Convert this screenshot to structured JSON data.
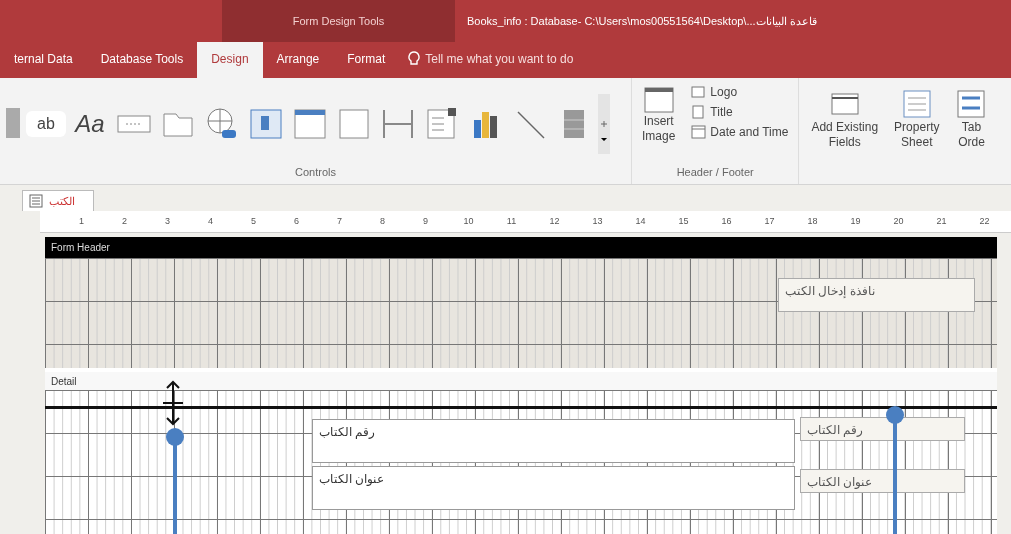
{
  "window": {
    "context_title": "Form Design Tools",
    "title": "Books_info : Database- C:\\Users\\mos00551564\\Desktop\\...قاعدة البيانات"
  },
  "tabs": [
    {
      "label": "ternal Data",
      "selected": false
    },
    {
      "label": "Database Tools",
      "selected": false
    },
    {
      "label": "Design",
      "selected": true
    },
    {
      "label": "Arrange",
      "selected": false
    },
    {
      "label": "Format",
      "selected": false
    }
  ],
  "tell_me": {
    "placeholder": "Tell me what you want to do"
  },
  "ribbon": {
    "controls": [
      {
        "kind": "select"
      },
      {
        "kind": "textbox",
        "glyph": "ab"
      },
      {
        "kind": "label",
        "glyph": "Aa"
      },
      {
        "kind": "button"
      },
      {
        "kind": "tab"
      },
      {
        "kind": "hyperlink"
      },
      {
        "kind": "navigation"
      },
      {
        "kind": "frame"
      },
      {
        "kind": "page"
      },
      {
        "kind": "pagebreak"
      },
      {
        "kind": "subform"
      },
      {
        "kind": "chart"
      },
      {
        "kind": "line"
      },
      {
        "kind": "toggle"
      }
    ],
    "controls_group": "Controls",
    "insert_image": [
      "Insert",
      "Image"
    ],
    "header_items": [
      {
        "kind": "logo",
        "label": "Logo"
      },
      {
        "kind": "title",
        "label": "Title"
      },
      {
        "kind": "datetime",
        "label": "Date and Time"
      }
    ],
    "header_group": "Header / Footer",
    "tools": [
      {
        "kind": "fields",
        "label": [
          "Add Existing",
          "Fields"
        ]
      },
      {
        "kind": "sheet",
        "label": [
          "Property",
          "Sheet"
        ]
      },
      {
        "kind": "order",
        "label": [
          "Tab",
          "Orde"
        ]
      }
    ]
  },
  "document_tab": {
    "label": "الكتب"
  },
  "ruler_marks": [
    "1",
    "2",
    "3",
    "4",
    "5",
    "6",
    "7",
    "8",
    "9",
    "10",
    "11",
    "12",
    "13",
    "14",
    "15",
    "16",
    "17",
    "18",
    "19",
    "20",
    "21",
    "22"
  ],
  "sections": [
    {
      "kind": "header",
      "title": "Form Header",
      "controls": [
        {
          "kind": "label",
          "text": "نافذة إدخال الكتب"
        }
      ]
    },
    {
      "kind": "detail",
      "title": "Detail",
      "controls": [
        {
          "kind": "textbox",
          "text": "رقم الكتاب"
        },
        {
          "kind": "textbox",
          "text": "عنوان الكتاب"
        },
        {
          "kind": "label",
          "text": "رقم الكتاب"
        },
        {
          "kind": "label",
          "text": "عنوان الكتاب"
        }
      ]
    }
  ]
}
